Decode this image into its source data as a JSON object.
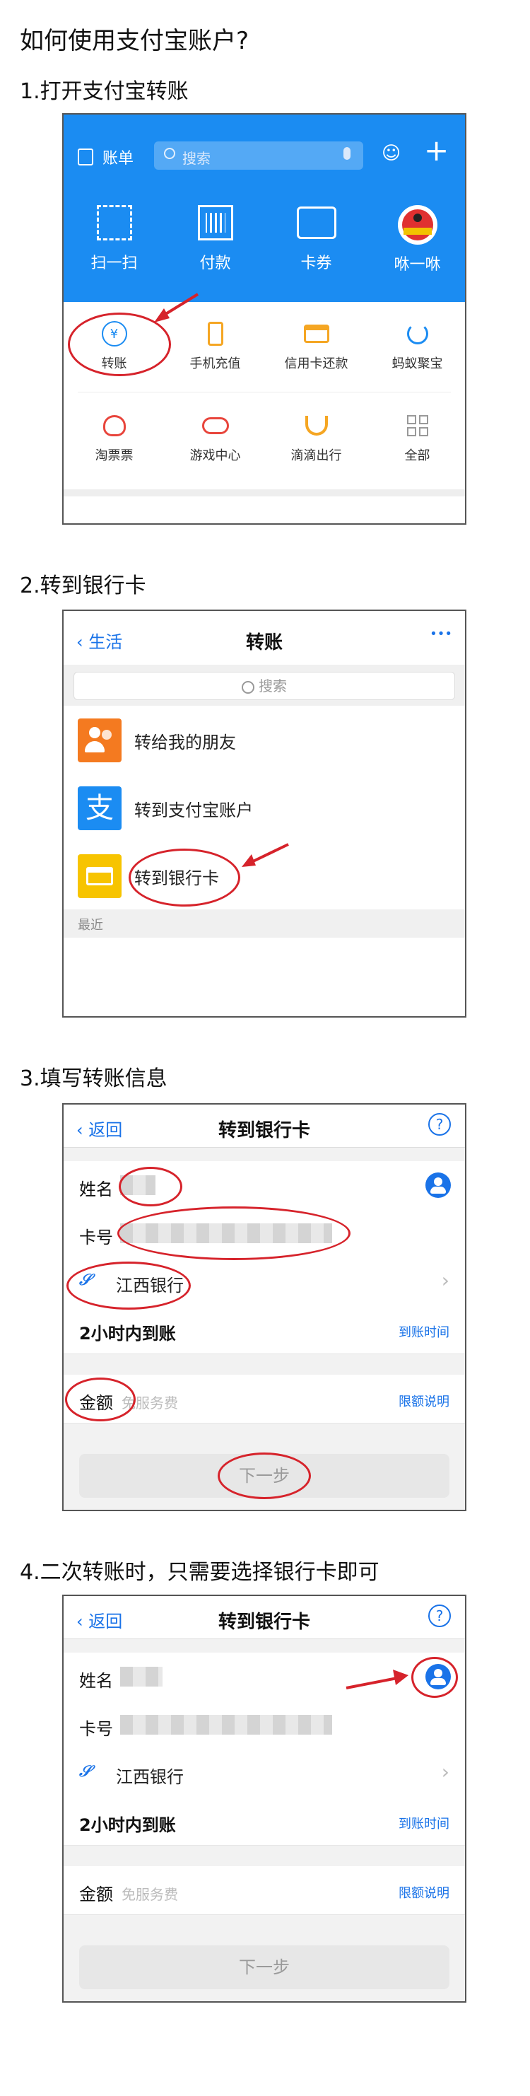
{
  "page": {
    "title": "如何使用支付宝账户?",
    "steps": [
      {
        "label": "1.打开支付宝转账"
      },
      {
        "label": "2.转到银行卡"
      },
      {
        "label": "3.填写转账信息"
      },
      {
        "label": "4.二次转账时，只需要选择银行卡即可"
      }
    ]
  },
  "step1": {
    "topbar": {
      "bill": "账单",
      "search_placeholder": "搜索"
    },
    "actions": [
      "扫一扫",
      "付款",
      "卡券",
      "咻一咻"
    ],
    "grid_row1": [
      "转账",
      "手机充值",
      "信用卡还款",
      "蚂蚁聚宝"
    ],
    "grid_row2": [
      "淘票票",
      "游戏中心",
      "滴滴出行",
      "全部"
    ],
    "icons": {
      "add": "+",
      "user": "user-icon",
      "mic": "mic-icon"
    }
  },
  "step2": {
    "nav": {
      "back": "生活",
      "title": "转账",
      "more": "•••"
    },
    "search_placeholder": "搜索",
    "items": [
      "转给我的朋友",
      "转到支付宝账户",
      "转到银行卡"
    ],
    "section": "最近"
  },
  "step3": {
    "nav": {
      "back": "返回",
      "title": "转到银行卡",
      "help": "?"
    },
    "fields": {
      "name_label": "姓名",
      "card_label": "卡号",
      "bank": "江西银行",
      "arrival": "2小时内到账",
      "arrival_link": "到账时间",
      "amount_label": "金额",
      "amount_placeholder": "免服务费",
      "limit_link": "限额说明",
      "next_button": "下一步"
    }
  },
  "step4": {
    "nav": {
      "back": "返回",
      "title": "转到银行卡",
      "help": "?"
    },
    "fields": {
      "name_label": "姓名",
      "card_label": "卡号",
      "bank": "江西银行",
      "arrival": "2小时内到账",
      "arrival_link": "到账时间",
      "amount_label": "金额",
      "amount_placeholder": "免服务费",
      "limit_link": "限额说明",
      "next_button": "下一步"
    }
  },
  "colors": {
    "alipay_blue": "#1b8cf2",
    "link_blue": "#1a73e8",
    "annotation_red": "#d6232b"
  }
}
